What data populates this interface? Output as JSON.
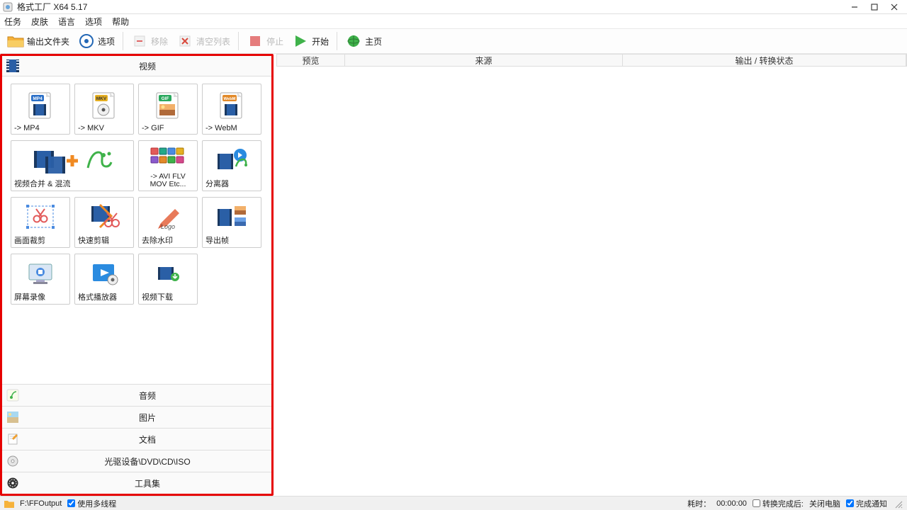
{
  "title": "格式工厂 X64 5.17",
  "menu": {
    "task": "任务",
    "skin": "皮肤",
    "language": "语言",
    "options": "选项",
    "help": "帮助"
  },
  "toolbar": {
    "output_folder": "输出文件夹",
    "options": "选项",
    "remove": "移除",
    "clear": "清空列表",
    "stop": "停止",
    "start": "开始",
    "home": "主页"
  },
  "categories": {
    "video": "视频",
    "audio": "音频",
    "image": "图片",
    "document": "文档",
    "disc": "光驱设备\\DVD\\CD\\ISO",
    "tools": "工具集"
  },
  "tiles": {
    "mp4": "-> MP4",
    "mkv": "-> MKV",
    "gif": "-> GIF",
    "webm": "-> WebM",
    "merge": "视频合并 & 混流",
    "avi": "-> AVI FLV MOV Etc...",
    "split": "分离器",
    "crop": "画面裁剪",
    "quickcut": "快速剪辑",
    "watermark": "去除水印",
    "exportframe": "导出帧",
    "screenrec": "屏幕录像",
    "player": "格式播放器",
    "download": "视频下载"
  },
  "badges": {
    "mp4": "MP4",
    "mkv": "MKV",
    "gif": "GIF",
    "webm": "WebM"
  },
  "logo": "Logo",
  "columns": {
    "preview": "预览",
    "source": "来源",
    "status": "输出 / 转换状态"
  },
  "status": {
    "path": "F:\\FFOutput",
    "multithread": "使用多线程",
    "time_label": "耗时：",
    "time_value": "00:00:00",
    "afterdone": "转换完成后:",
    "shutdown": "关闭电脑",
    "notify": "完成通知"
  }
}
